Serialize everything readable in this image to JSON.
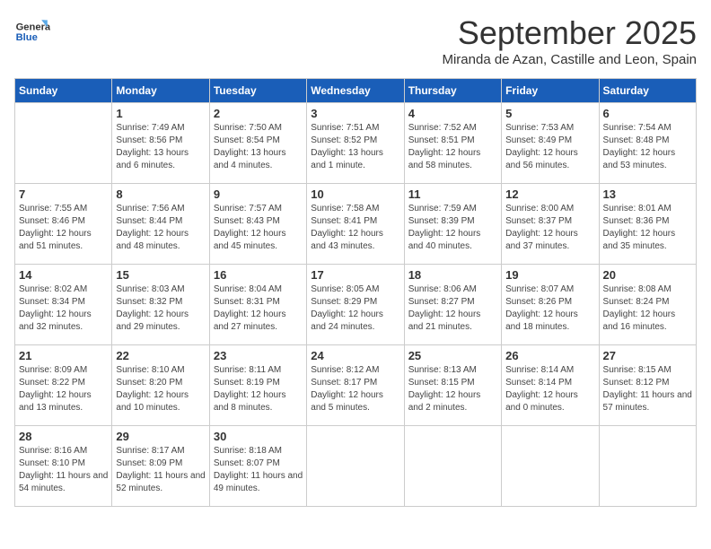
{
  "header": {
    "logo_general": "General",
    "logo_blue": "Blue",
    "month": "September 2025",
    "location": "Miranda de Azan, Castille and Leon, Spain"
  },
  "weekdays": [
    "Sunday",
    "Monday",
    "Tuesday",
    "Wednesday",
    "Thursday",
    "Friday",
    "Saturday"
  ],
  "weeks": [
    [
      {
        "day": "",
        "sunrise": "",
        "sunset": "",
        "daylight": ""
      },
      {
        "day": "1",
        "sunrise": "Sunrise: 7:49 AM",
        "sunset": "Sunset: 8:56 PM",
        "daylight": "Daylight: 13 hours and 6 minutes."
      },
      {
        "day": "2",
        "sunrise": "Sunrise: 7:50 AM",
        "sunset": "Sunset: 8:54 PM",
        "daylight": "Daylight: 13 hours and 4 minutes."
      },
      {
        "day": "3",
        "sunrise": "Sunrise: 7:51 AM",
        "sunset": "Sunset: 8:52 PM",
        "daylight": "Daylight: 13 hours and 1 minute."
      },
      {
        "day": "4",
        "sunrise": "Sunrise: 7:52 AM",
        "sunset": "Sunset: 8:51 PM",
        "daylight": "Daylight: 12 hours and 58 minutes."
      },
      {
        "day": "5",
        "sunrise": "Sunrise: 7:53 AM",
        "sunset": "Sunset: 8:49 PM",
        "daylight": "Daylight: 12 hours and 56 minutes."
      },
      {
        "day": "6",
        "sunrise": "Sunrise: 7:54 AM",
        "sunset": "Sunset: 8:48 PM",
        "daylight": "Daylight: 12 hours and 53 minutes."
      }
    ],
    [
      {
        "day": "7",
        "sunrise": "Sunrise: 7:55 AM",
        "sunset": "Sunset: 8:46 PM",
        "daylight": "Daylight: 12 hours and 51 minutes."
      },
      {
        "day": "8",
        "sunrise": "Sunrise: 7:56 AM",
        "sunset": "Sunset: 8:44 PM",
        "daylight": "Daylight: 12 hours and 48 minutes."
      },
      {
        "day": "9",
        "sunrise": "Sunrise: 7:57 AM",
        "sunset": "Sunset: 8:43 PM",
        "daylight": "Daylight: 12 hours and 45 minutes."
      },
      {
        "day": "10",
        "sunrise": "Sunrise: 7:58 AM",
        "sunset": "Sunset: 8:41 PM",
        "daylight": "Daylight: 12 hours and 43 minutes."
      },
      {
        "day": "11",
        "sunrise": "Sunrise: 7:59 AM",
        "sunset": "Sunset: 8:39 PM",
        "daylight": "Daylight: 12 hours and 40 minutes."
      },
      {
        "day": "12",
        "sunrise": "Sunrise: 8:00 AM",
        "sunset": "Sunset: 8:37 PM",
        "daylight": "Daylight: 12 hours and 37 minutes."
      },
      {
        "day": "13",
        "sunrise": "Sunrise: 8:01 AM",
        "sunset": "Sunset: 8:36 PM",
        "daylight": "Daylight: 12 hours and 35 minutes."
      }
    ],
    [
      {
        "day": "14",
        "sunrise": "Sunrise: 8:02 AM",
        "sunset": "Sunset: 8:34 PM",
        "daylight": "Daylight: 12 hours and 32 minutes."
      },
      {
        "day": "15",
        "sunrise": "Sunrise: 8:03 AM",
        "sunset": "Sunset: 8:32 PM",
        "daylight": "Daylight: 12 hours and 29 minutes."
      },
      {
        "day": "16",
        "sunrise": "Sunrise: 8:04 AM",
        "sunset": "Sunset: 8:31 PM",
        "daylight": "Daylight: 12 hours and 27 minutes."
      },
      {
        "day": "17",
        "sunrise": "Sunrise: 8:05 AM",
        "sunset": "Sunset: 8:29 PM",
        "daylight": "Daylight: 12 hours and 24 minutes."
      },
      {
        "day": "18",
        "sunrise": "Sunrise: 8:06 AM",
        "sunset": "Sunset: 8:27 PM",
        "daylight": "Daylight: 12 hours and 21 minutes."
      },
      {
        "day": "19",
        "sunrise": "Sunrise: 8:07 AM",
        "sunset": "Sunset: 8:26 PM",
        "daylight": "Daylight: 12 hours and 18 minutes."
      },
      {
        "day": "20",
        "sunrise": "Sunrise: 8:08 AM",
        "sunset": "Sunset: 8:24 PM",
        "daylight": "Daylight: 12 hours and 16 minutes."
      }
    ],
    [
      {
        "day": "21",
        "sunrise": "Sunrise: 8:09 AM",
        "sunset": "Sunset: 8:22 PM",
        "daylight": "Daylight: 12 hours and 13 minutes."
      },
      {
        "day": "22",
        "sunrise": "Sunrise: 8:10 AM",
        "sunset": "Sunset: 8:20 PM",
        "daylight": "Daylight: 12 hours and 10 minutes."
      },
      {
        "day": "23",
        "sunrise": "Sunrise: 8:11 AM",
        "sunset": "Sunset: 8:19 PM",
        "daylight": "Daylight: 12 hours and 8 minutes."
      },
      {
        "day": "24",
        "sunrise": "Sunrise: 8:12 AM",
        "sunset": "Sunset: 8:17 PM",
        "daylight": "Daylight: 12 hours and 5 minutes."
      },
      {
        "day": "25",
        "sunrise": "Sunrise: 8:13 AM",
        "sunset": "Sunset: 8:15 PM",
        "daylight": "Daylight: 12 hours and 2 minutes."
      },
      {
        "day": "26",
        "sunrise": "Sunrise: 8:14 AM",
        "sunset": "Sunset: 8:14 PM",
        "daylight": "Daylight: 12 hours and 0 minutes."
      },
      {
        "day": "27",
        "sunrise": "Sunrise: 8:15 AM",
        "sunset": "Sunset: 8:12 PM",
        "daylight": "Daylight: 11 hours and 57 minutes."
      }
    ],
    [
      {
        "day": "28",
        "sunrise": "Sunrise: 8:16 AM",
        "sunset": "Sunset: 8:10 PM",
        "daylight": "Daylight: 11 hours and 54 minutes."
      },
      {
        "day": "29",
        "sunrise": "Sunrise: 8:17 AM",
        "sunset": "Sunset: 8:09 PM",
        "daylight": "Daylight: 11 hours and 52 minutes."
      },
      {
        "day": "30",
        "sunrise": "Sunrise: 8:18 AM",
        "sunset": "Sunset: 8:07 PM",
        "daylight": "Daylight: 11 hours and 49 minutes."
      },
      {
        "day": "",
        "sunrise": "",
        "sunset": "",
        "daylight": ""
      },
      {
        "day": "",
        "sunrise": "",
        "sunset": "",
        "daylight": ""
      },
      {
        "day": "",
        "sunrise": "",
        "sunset": "",
        "daylight": ""
      },
      {
        "day": "",
        "sunrise": "",
        "sunset": "",
        "daylight": ""
      }
    ]
  ]
}
